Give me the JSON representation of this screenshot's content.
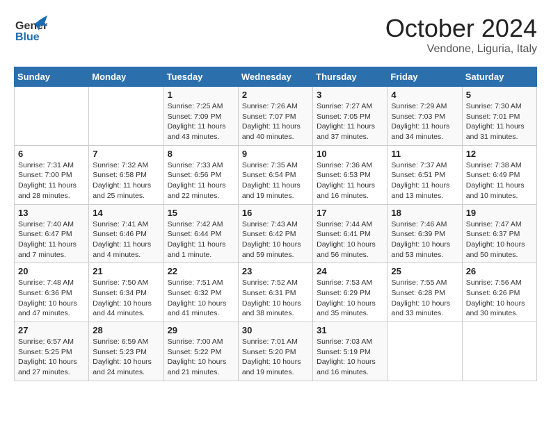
{
  "header": {
    "logo_line1": "General",
    "logo_line2": "Blue",
    "month": "October 2024",
    "location": "Vendone, Liguria, Italy"
  },
  "weekdays": [
    "Sunday",
    "Monday",
    "Tuesday",
    "Wednesday",
    "Thursday",
    "Friday",
    "Saturday"
  ],
  "weeks": [
    [
      {
        "day": "",
        "detail": ""
      },
      {
        "day": "",
        "detail": ""
      },
      {
        "day": "1",
        "detail": "Sunrise: 7:25 AM\nSunset: 7:09 PM\nDaylight: 11 hours and 43 minutes."
      },
      {
        "day": "2",
        "detail": "Sunrise: 7:26 AM\nSunset: 7:07 PM\nDaylight: 11 hours and 40 minutes."
      },
      {
        "day": "3",
        "detail": "Sunrise: 7:27 AM\nSunset: 7:05 PM\nDaylight: 11 hours and 37 minutes."
      },
      {
        "day": "4",
        "detail": "Sunrise: 7:29 AM\nSunset: 7:03 PM\nDaylight: 11 hours and 34 minutes."
      },
      {
        "day": "5",
        "detail": "Sunrise: 7:30 AM\nSunset: 7:01 PM\nDaylight: 11 hours and 31 minutes."
      }
    ],
    [
      {
        "day": "6",
        "detail": "Sunrise: 7:31 AM\nSunset: 7:00 PM\nDaylight: 11 hours and 28 minutes."
      },
      {
        "day": "7",
        "detail": "Sunrise: 7:32 AM\nSunset: 6:58 PM\nDaylight: 11 hours and 25 minutes."
      },
      {
        "day": "8",
        "detail": "Sunrise: 7:33 AM\nSunset: 6:56 PM\nDaylight: 11 hours and 22 minutes."
      },
      {
        "day": "9",
        "detail": "Sunrise: 7:35 AM\nSunset: 6:54 PM\nDaylight: 11 hours and 19 minutes."
      },
      {
        "day": "10",
        "detail": "Sunrise: 7:36 AM\nSunset: 6:53 PM\nDaylight: 11 hours and 16 minutes."
      },
      {
        "day": "11",
        "detail": "Sunrise: 7:37 AM\nSunset: 6:51 PM\nDaylight: 11 hours and 13 minutes."
      },
      {
        "day": "12",
        "detail": "Sunrise: 7:38 AM\nSunset: 6:49 PM\nDaylight: 11 hours and 10 minutes."
      }
    ],
    [
      {
        "day": "13",
        "detail": "Sunrise: 7:40 AM\nSunset: 6:47 PM\nDaylight: 11 hours and 7 minutes."
      },
      {
        "day": "14",
        "detail": "Sunrise: 7:41 AM\nSunset: 6:46 PM\nDaylight: 11 hours and 4 minutes."
      },
      {
        "day": "15",
        "detail": "Sunrise: 7:42 AM\nSunset: 6:44 PM\nDaylight: 11 hours and 1 minute."
      },
      {
        "day": "16",
        "detail": "Sunrise: 7:43 AM\nSunset: 6:42 PM\nDaylight: 10 hours and 59 minutes."
      },
      {
        "day": "17",
        "detail": "Sunrise: 7:44 AM\nSunset: 6:41 PM\nDaylight: 10 hours and 56 minutes."
      },
      {
        "day": "18",
        "detail": "Sunrise: 7:46 AM\nSunset: 6:39 PM\nDaylight: 10 hours and 53 minutes."
      },
      {
        "day": "19",
        "detail": "Sunrise: 7:47 AM\nSunset: 6:37 PM\nDaylight: 10 hours and 50 minutes."
      }
    ],
    [
      {
        "day": "20",
        "detail": "Sunrise: 7:48 AM\nSunset: 6:36 PM\nDaylight: 10 hours and 47 minutes."
      },
      {
        "day": "21",
        "detail": "Sunrise: 7:50 AM\nSunset: 6:34 PM\nDaylight: 10 hours and 44 minutes."
      },
      {
        "day": "22",
        "detail": "Sunrise: 7:51 AM\nSunset: 6:32 PM\nDaylight: 10 hours and 41 minutes."
      },
      {
        "day": "23",
        "detail": "Sunrise: 7:52 AM\nSunset: 6:31 PM\nDaylight: 10 hours and 38 minutes."
      },
      {
        "day": "24",
        "detail": "Sunrise: 7:53 AM\nSunset: 6:29 PM\nDaylight: 10 hours and 35 minutes."
      },
      {
        "day": "25",
        "detail": "Sunrise: 7:55 AM\nSunset: 6:28 PM\nDaylight: 10 hours and 33 minutes."
      },
      {
        "day": "26",
        "detail": "Sunrise: 7:56 AM\nSunset: 6:26 PM\nDaylight: 10 hours and 30 minutes."
      }
    ],
    [
      {
        "day": "27",
        "detail": "Sunrise: 6:57 AM\nSunset: 5:25 PM\nDaylight: 10 hours and 27 minutes."
      },
      {
        "day": "28",
        "detail": "Sunrise: 6:59 AM\nSunset: 5:23 PM\nDaylight: 10 hours and 24 minutes."
      },
      {
        "day": "29",
        "detail": "Sunrise: 7:00 AM\nSunset: 5:22 PM\nDaylight: 10 hours and 21 minutes."
      },
      {
        "day": "30",
        "detail": "Sunrise: 7:01 AM\nSunset: 5:20 PM\nDaylight: 10 hours and 19 minutes."
      },
      {
        "day": "31",
        "detail": "Sunrise: 7:03 AM\nSunset: 5:19 PM\nDaylight: 10 hours and 16 minutes."
      },
      {
        "day": "",
        "detail": ""
      },
      {
        "day": "",
        "detail": ""
      }
    ]
  ]
}
